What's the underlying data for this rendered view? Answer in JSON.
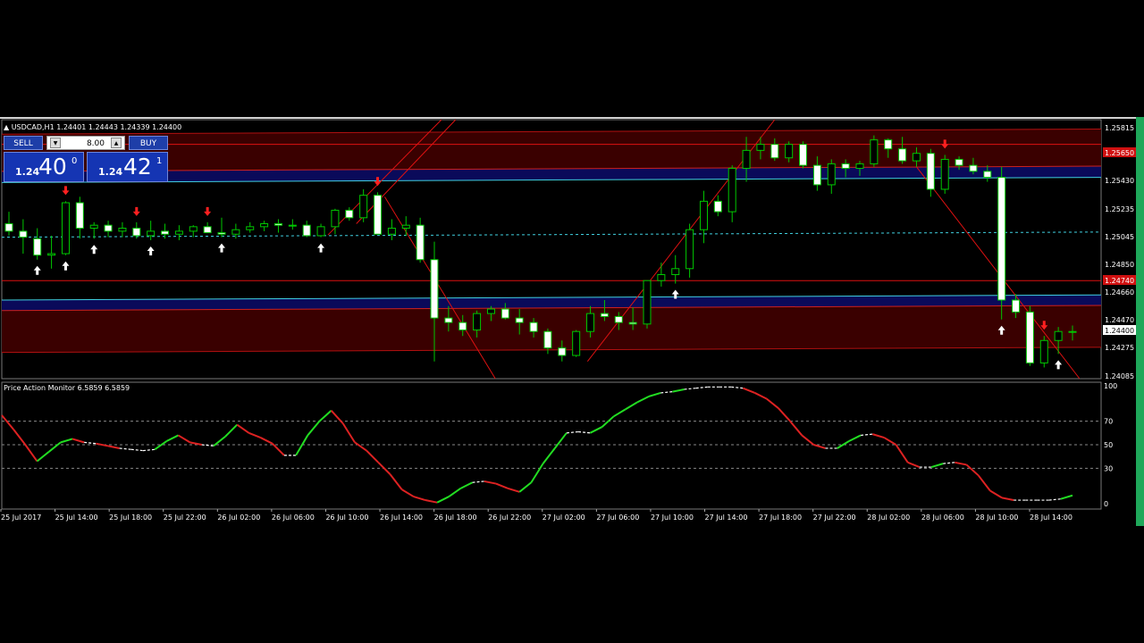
{
  "symbol_line": "USDCAD,H1  1.24401 1.24443 1.24339 1.24400",
  "trade_panel": {
    "sell_label": "SELL",
    "buy_label": "BUY",
    "lot_value": "8.00",
    "bid_prefix": "1.24",
    "bid_big": "40",
    "bid_sup": "0",
    "ask_prefix": "1.24",
    "ask_big": "42",
    "ask_sup": "1"
  },
  "price_axis": [
    "1.25815",
    "1.25650",
    "1.25430",
    "1.25235",
    "1.25045",
    "1.24850",
    "1.24740",
    "1.24660",
    "1.24470",
    "1.24400",
    "1.24275",
    "1.24085"
  ],
  "indicator_title": "Price Action Monitor 6.5859 6.5859",
  "indicator_axis": [
    "100",
    "70",
    "50",
    "30",
    "0"
  ],
  "time_axis": [
    "25 Jul 2017",
    "25 Jul 14:00",
    "25 Jul 18:00",
    "25 Jul 22:00",
    "26 Jul 02:00",
    "26 Jul 06:00",
    "26 Jul 10:00",
    "26 Jul 14:00",
    "26 Jul 18:00",
    "26 Jul 22:00",
    "27 Jul 02:00",
    "27 Jul 06:00",
    "27 Jul 10:00",
    "27 Jul 14:00",
    "27 Jul 18:00",
    "27 Jul 22:00",
    "28 Jul 02:00",
    "28 Jul 06:00",
    "28 Jul 10:00",
    "28 Jul 14:00"
  ],
  "colors": {
    "background": "#000000",
    "bull": "#00c800",
    "bear_body": "#ffffff",
    "band_fill": "#3a0000",
    "band_blue": "#0a0a5a",
    "cyan": "#40d0e0",
    "red_line": "#dd1111",
    "osc_up": "#22dd22",
    "osc_down": "#dd2222",
    "osc_flat": "#ffffff"
  },
  "chart_data": {
    "type": "candlestick",
    "symbol": "USDCAD",
    "timeframe": "H1",
    "ylim": [
      1.24085,
      1.25815
    ],
    "ohlc": [
      [
        1.2512,
        1.252,
        1.2504,
        1.2507
      ],
      [
        1.2507,
        1.2515,
        1.2492,
        1.2503
      ],
      [
        1.2502,
        1.2509,
        1.2488,
        1.2491
      ],
      [
        1.2491,
        1.2504,
        1.2482,
        1.2492
      ],
      [
        1.2492,
        1.2527,
        1.2491,
        1.2526
      ],
      [
        1.2526,
        1.253,
        1.2502,
        1.2509
      ],
      [
        1.2509,
        1.2513,
        1.2502,
        1.2511
      ],
      [
        1.2511,
        1.2514,
        1.2503,
        1.2507
      ],
      [
        1.2507,
        1.2513,
        1.2503,
        1.2509
      ],
      [
        1.2509,
        1.2513,
        1.2502,
        1.2504
      ],
      [
        1.2504,
        1.2514,
        1.2501,
        1.2507
      ],
      [
        1.2507,
        1.2512,
        1.2502,
        1.2505
      ],
      [
        1.2505,
        1.2511,
        1.2501,
        1.2507
      ],
      [
        1.2507,
        1.2511,
        1.2503,
        1.251
      ],
      [
        1.251,
        1.2513,
        1.2506,
        1.2506
      ],
      [
        1.2506,
        1.2516,
        1.2503,
        1.2505
      ],
      [
        1.2505,
        1.2512,
        1.2502,
        1.2508
      ],
      [
        1.2508,
        1.2513,
        1.2506,
        1.251
      ],
      [
        1.251,
        1.2514,
        1.2507,
        1.2512
      ],
      [
        1.2512,
        1.2515,
        1.2506,
        1.2511
      ],
      [
        1.2511,
        1.2515,
        1.2508,
        1.2511
      ],
      [
        1.2511,
        1.2514,
        1.2503,
        1.2504
      ],
      [
        1.2504,
        1.2512,
        1.2503,
        1.251
      ],
      [
        1.251,
        1.2522,
        1.2505,
        1.2521
      ],
      [
        1.2521,
        1.2523,
        1.2514,
        1.2516
      ],
      [
        1.2516,
        1.2535,
        1.2513,
        1.2531
      ],
      [
        1.2531,
        1.2533,
        1.2505,
        1.2505
      ],
      [
        1.2505,
        1.2515,
        1.2501,
        1.2509
      ],
      [
        1.2509,
        1.2517,
        1.2504,
        1.2511
      ],
      [
        1.2511,
        1.2516,
        1.2486,
        1.2488
      ],
      [
        1.2488,
        1.25,
        1.242,
        1.2449
      ],
      [
        1.2449,
        1.2457,
        1.244,
        1.2446
      ],
      [
        1.2446,
        1.2451,
        1.2437,
        1.2441
      ],
      [
        1.2441,
        1.2454,
        1.2436,
        1.2452
      ],
      [
        1.2452,
        1.2457,
        1.2447,
        1.2455
      ],
      [
        1.2455,
        1.2459,
        1.2448,
        1.2449
      ],
      [
        1.2449,
        1.2455,
        1.2438,
        1.2446
      ],
      [
        1.2446,
        1.2449,
        1.2436,
        1.244
      ],
      [
        1.244,
        1.2442,
        1.2425,
        1.2429
      ],
      [
        1.2429,
        1.2434,
        1.242,
        1.2424
      ],
      [
        1.2424,
        1.2441,
        1.2423,
        1.244
      ],
      [
        1.244,
        1.2457,
        1.2436,
        1.2452
      ],
      [
        1.2452,
        1.2461,
        1.2447,
        1.245
      ],
      [
        1.245,
        1.2453,
        1.2441,
        1.2446
      ],
      [
        1.2446,
        1.2456,
        1.2441,
        1.2445
      ],
      [
        1.2445,
        1.2474,
        1.2442,
        1.2474
      ],
      [
        1.2474,
        1.2486,
        1.247,
        1.2478
      ],
      [
        1.2478,
        1.2491,
        1.2472,
        1.2482
      ],
      [
        1.2482,
        1.2512,
        1.2476,
        1.2508
      ],
      [
        1.2508,
        1.2534,
        1.2499,
        1.2527
      ],
      [
        1.2527,
        1.2531,
        1.2517,
        1.252
      ],
      [
        1.252,
        1.2551,
        1.2513,
        1.2549
      ],
      [
        1.2549,
        1.257,
        1.254,
        1.2561
      ],
      [
        1.2561,
        1.257,
        1.2555,
        1.2565
      ],
      [
        1.2565,
        1.2569,
        1.2554,
        1.2556
      ],
      [
        1.2556,
        1.2567,
        1.2553,
        1.2565
      ],
      [
        1.2565,
        1.2567,
        1.2549,
        1.2551
      ],
      [
        1.2551,
        1.2557,
        1.2534,
        1.2538
      ],
      [
        1.2538,
        1.2555,
        1.2532,
        1.2552
      ],
      [
        1.2552,
        1.2555,
        1.2543,
        1.2549
      ],
      [
        1.2549,
        1.2554,
        1.2544,
        1.2552
      ],
      [
        1.2552,
        1.2571,
        1.255,
        1.2568
      ],
      [
        1.2568,
        1.2569,
        1.2556,
        1.2562
      ],
      [
        1.2562,
        1.257,
        1.2552,
        1.2554
      ],
      [
        1.2554,
        1.2563,
        1.255,
        1.2559
      ],
      [
        1.2559,
        1.2562,
        1.253,
        1.2535
      ],
      [
        1.2535,
        1.2558,
        1.2532,
        1.2555
      ],
      [
        1.2555,
        1.2557,
        1.2548,
        1.2551
      ],
      [
        1.2551,
        1.2556,
        1.2545,
        1.2547
      ],
      [
        1.2547,
        1.2551,
        1.254,
        1.2543
      ],
      [
        1.2543,
        1.255,
        1.2448,
        1.2461
      ],
      [
        1.2461,
        1.2465,
        1.2449,
        1.2453
      ],
      [
        1.2453,
        1.2457,
        1.2417,
        1.2419
      ],
      [
        1.2419,
        1.2437,
        1.2416,
        1.2434
      ],
      [
        1.2434,
        1.2443,
        1.2425,
        1.244
      ],
      [
        1.244,
        1.2444,
        1.2434,
        1.244
      ]
    ],
    "oscillator": {
      "name": "Price Action Monitor",
      "value": 6.5859,
      "ylim": [
        0,
        100
      ],
      "levels": [
        70,
        50,
        30
      ],
      "values": [
        75,
        63,
        50,
        36,
        44,
        52,
        55,
        52,
        51,
        49,
        47,
        46,
        45,
        46,
        53,
        58,
        52,
        50,
        49,
        57,
        67,
        60,
        56,
        51,
        41,
        41,
        58,
        70,
        79,
        68,
        52,
        45,
        35,
        25,
        12,
        6,
        3,
        1,
        6,
        13,
        18,
        19,
        17,
        13,
        10,
        18,
        34,
        47,
        60,
        61,
        60,
        65,
        74,
        80,
        86,
        91,
        94,
        95,
        97,
        98,
        99,
        99,
        99,
        98,
        94,
        89,
        81,
        70,
        58,
        50,
        47,
        47,
        53,
        58,
        59,
        56,
        50,
        35,
        31,
        31,
        34,
        35,
        33,
        24,
        11,
        5,
        3,
        3,
        3,
        3,
        4,
        7
      ]
    }
  }
}
